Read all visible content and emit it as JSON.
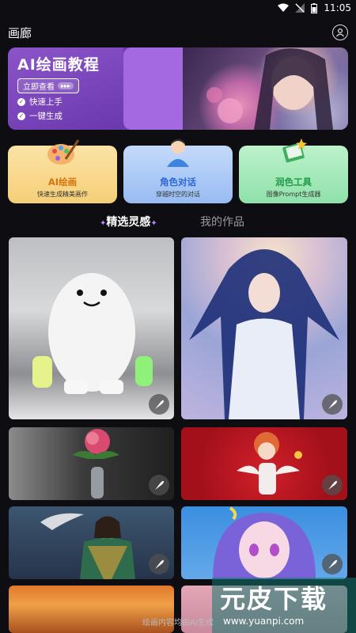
{
  "status": {
    "time": "11:05"
  },
  "header": {
    "title": "画廊"
  },
  "banner": {
    "title": "AI绘画教程",
    "button_label": "立即查看",
    "button_arrows": "▸▸▸",
    "features": [
      "快速上手",
      "一键生成"
    ]
  },
  "feature_cards": [
    {
      "title": "AI绘画",
      "subtitle": "快速生成精美画作",
      "title_color": "#d9730d",
      "bg": "#f8d78e",
      "icon": "palette-icon"
    },
    {
      "title": "角色对话",
      "subtitle": "穿越时空的对话",
      "title_color": "#2f66d6",
      "bg": "#a9c8f6",
      "icon": "person-icon"
    },
    {
      "title": "润色工具",
      "subtitle": "图像Prompt生成器",
      "title_color": "#1f9a4a",
      "bg": "#9ee7b5",
      "icon": "book-icon"
    }
  ],
  "tabs": {
    "active": "精选灵感",
    "inactive": "我的作品",
    "spark": "✦"
  },
  "gallery": [
    {
      "name": "white-creature-image"
    },
    {
      "name": "blue-hair-girl-image"
    },
    {
      "name": "peony-vase-image"
    },
    {
      "name": "cupid-figure-image"
    },
    {
      "name": "fairy-bird-image"
    },
    {
      "name": "purple-anime-girl-image"
    },
    {
      "name": "sunset-image"
    },
    {
      "name": "pink-image"
    }
  ],
  "footer": {
    "note": "绘画内容均由AI生成"
  },
  "watermark": {
    "text": "元皮下载",
    "url": "www.yuanpi.com"
  }
}
